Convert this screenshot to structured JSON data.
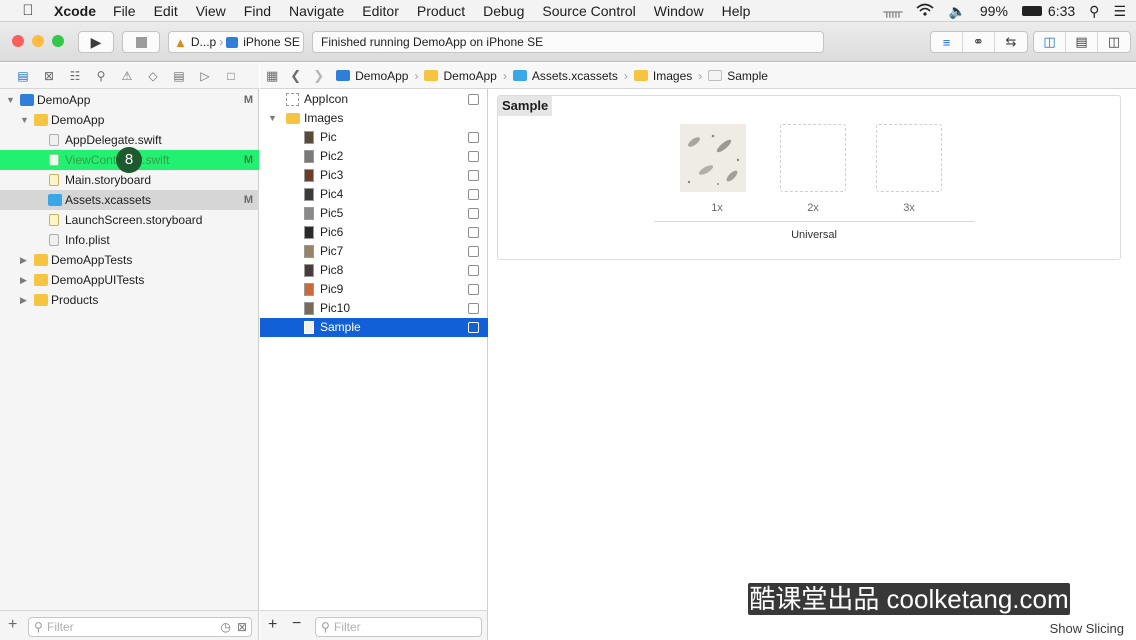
{
  "menubar": {
    "app_name": "Xcode",
    "menus": [
      "File",
      "Edit",
      "View",
      "Find",
      "Navigate",
      "Editor",
      "Product",
      "Debug",
      "Source Control",
      "Window",
      "Help"
    ],
    "battery": "99%",
    "time": "6:33"
  },
  "toolbar": {
    "scheme": "D...p",
    "device": "iPhone SE",
    "status": "Finished running DemoApp on iPhone SE"
  },
  "navigator": {
    "items": [
      {
        "label": "DemoApp",
        "badge": "M"
      },
      {
        "label": "DemoApp",
        "badge": ""
      },
      {
        "label": "AppDelegate.swift",
        "badge": ""
      },
      {
        "label": "ViewController.swift",
        "badge": "M"
      },
      {
        "label": "Main.storyboard",
        "badge": ""
      },
      {
        "label": "Assets.xcassets",
        "badge": "M"
      },
      {
        "label": "LaunchScreen.storyboard",
        "badge": ""
      },
      {
        "label": "Info.plist",
        "badge": ""
      },
      {
        "label": "DemoAppTests",
        "badge": ""
      },
      {
        "label": "DemoAppUITests",
        "badge": ""
      },
      {
        "label": "Products",
        "badge": ""
      }
    ],
    "filter_placeholder": "Filter",
    "click_marker": "8"
  },
  "jumpbar": {
    "crumbs": [
      "DemoApp",
      "DemoApp",
      "Assets.xcassets",
      "Images",
      "Sample"
    ]
  },
  "assets": {
    "items": [
      "AppIcon",
      "Images",
      "Pic",
      "Pic2",
      "Pic3",
      "Pic4",
      "Pic5",
      "Pic6",
      "Pic7",
      "Pic8",
      "Pic9",
      "Pic10",
      "Sample"
    ],
    "filter_placeholder": "Filter"
  },
  "detail": {
    "set_name": "Sample",
    "scales": [
      "1x",
      "2x",
      "3x"
    ],
    "idiom": "Universal",
    "show_slicing": "Show Slicing"
  },
  "watermark": "酷课堂出品 coolketang.com",
  "colors": {
    "selection": "#1160d8",
    "highlight_row": "#22f070",
    "folder": "#f5c541",
    "accent": "#1b6fd8"
  }
}
